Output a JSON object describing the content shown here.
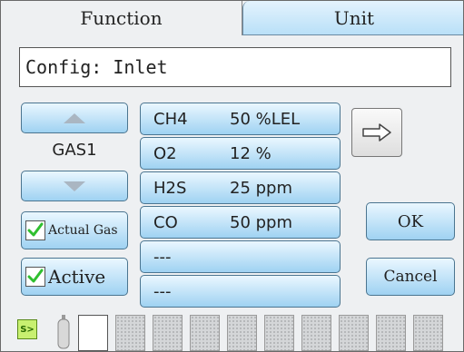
{
  "tabs": [
    {
      "label": "Function",
      "selected": true
    },
    {
      "label": "Unit",
      "selected": false
    }
  ],
  "config": {
    "text": "Config: Inlet"
  },
  "gas_selector": {
    "label": "GAS1",
    "up_icon": "triangle-up-icon",
    "down_icon": "triangle-down-icon"
  },
  "checkboxes": {
    "actual_gas": {
      "label": "Actual Gas",
      "checked": true
    },
    "active": {
      "label": "Active",
      "checked": true
    }
  },
  "gas_list": [
    {
      "name": "CH4",
      "value": "50 %LEL"
    },
    {
      "name": "O2",
      "value": "12 %"
    },
    {
      "name": "H2S",
      "value": "25 ppm"
    },
    {
      "name": "CO",
      "value": "50 ppm"
    },
    {
      "name": "---",
      "value": ""
    },
    {
      "name": "---",
      "value": ""
    }
  ],
  "buttons": {
    "next_icon": "arrow-right-icon",
    "ok": "OK",
    "cancel": "Cancel"
  },
  "status": {
    "run_icon_text": "S>",
    "cylinder_icon": "gas-cylinder-icon",
    "slots": 10
  },
  "colors": {
    "button_top": "#eaf7ff",
    "button_bottom": "#9fd2f2",
    "check": "#2fbf2f",
    "background": "#eef0f2"
  }
}
